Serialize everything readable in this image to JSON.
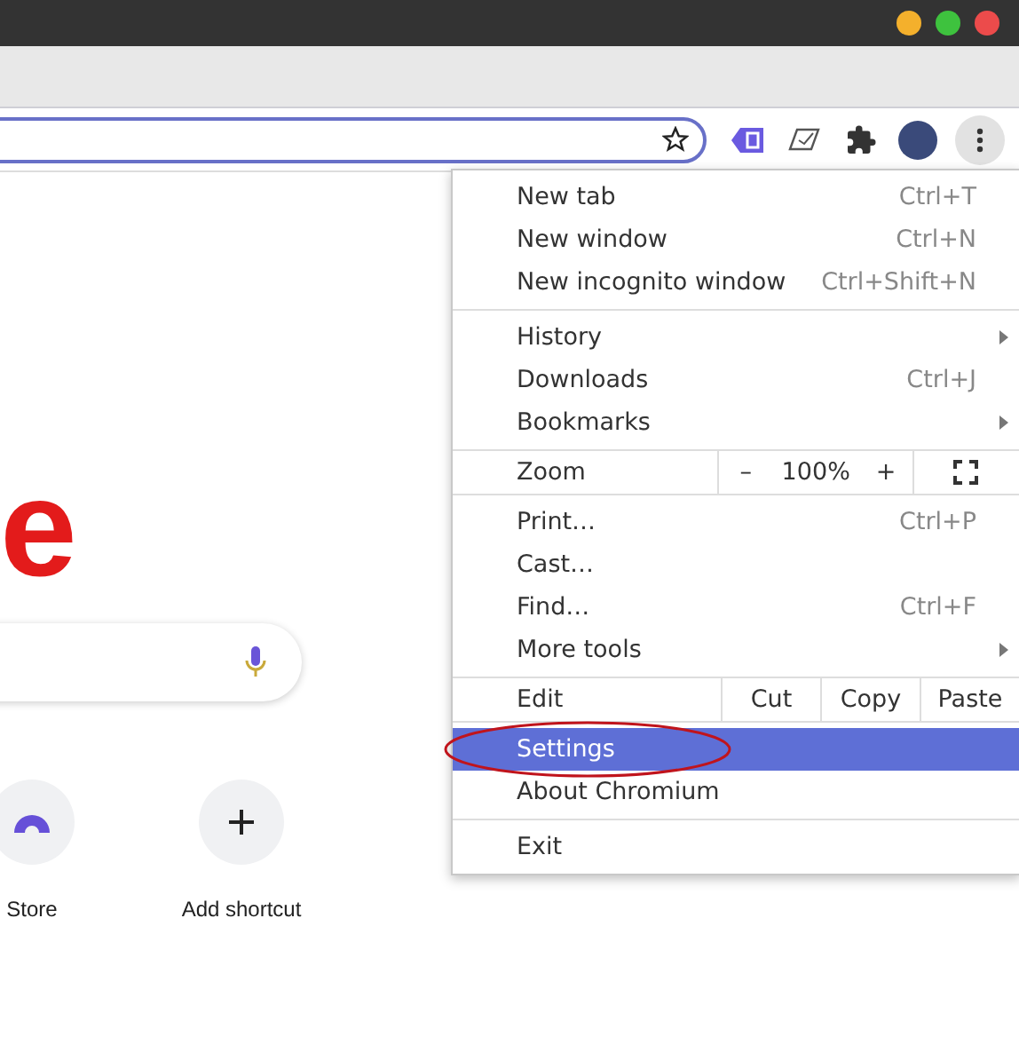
{
  "window": {
    "controls": [
      {
        "kind": "minimize"
      },
      {
        "kind": "maximize"
      },
      {
        "kind": "close"
      }
    ]
  },
  "logo": {
    "text": "e"
  },
  "shortcuts": [
    {
      "label": "Store",
      "kind": "store"
    },
    {
      "label": "Add shortcut",
      "kind": "add"
    }
  ],
  "menu": {
    "sections": [
      {
        "items": [
          {
            "kind": "item",
            "label": "New tab",
            "shortcut": "Ctrl+T",
            "submenu": false,
            "selected": false
          },
          {
            "kind": "item",
            "label": "New window",
            "shortcut": "Ctrl+N",
            "submenu": false,
            "selected": false
          },
          {
            "kind": "item",
            "label": "New incognito window",
            "shortcut": "Ctrl+Shift+N",
            "submenu": false,
            "selected": false
          }
        ]
      },
      {
        "items": [
          {
            "kind": "item",
            "label": "History",
            "submenu": true,
            "selected": false
          },
          {
            "kind": "item",
            "label": "Downloads",
            "shortcut": "Ctrl+J",
            "submenu": false,
            "selected": false
          },
          {
            "kind": "item",
            "label": "Bookmarks",
            "submenu": true,
            "selected": false
          }
        ]
      },
      {
        "items": [
          {
            "kind": "zoom",
            "label": "Zoom",
            "minus": "–",
            "value": "100%",
            "plus": "+"
          }
        ]
      },
      {
        "items": [
          {
            "kind": "item",
            "label": "Print…",
            "shortcut": "Ctrl+P",
            "submenu": false,
            "selected": false
          },
          {
            "kind": "item",
            "label": "Cast…",
            "submenu": false,
            "selected": false
          },
          {
            "kind": "item",
            "label": "Find…",
            "shortcut": "Ctrl+F",
            "submenu": false,
            "selected": false
          },
          {
            "kind": "item",
            "label": "More tools",
            "submenu": true,
            "selected": false
          }
        ]
      },
      {
        "items": [
          {
            "kind": "edit",
            "label": "Edit",
            "buttons": [
              "Cut",
              "Copy",
              "Paste"
            ]
          }
        ]
      },
      {
        "items": [
          {
            "kind": "item",
            "label": "Settings",
            "submenu": false,
            "selected": true,
            "circled": true
          },
          {
            "kind": "item",
            "label": "About Chromium",
            "submenu": false,
            "selected": false
          }
        ]
      },
      {
        "items": [
          {
            "kind": "item",
            "label": "Exit",
            "submenu": false,
            "selected": false
          }
        ]
      }
    ]
  }
}
